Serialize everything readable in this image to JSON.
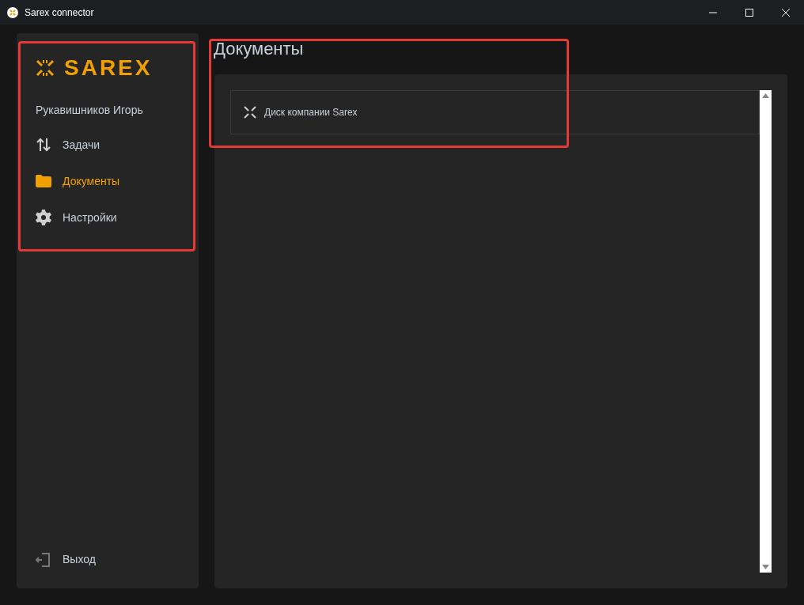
{
  "window": {
    "title": "Sarex connector"
  },
  "sidebar": {
    "logo": "SAREX",
    "user": "Рукавишников Игорь",
    "items": [
      {
        "kind": "tasks",
        "label": "Задачи",
        "selected": false
      },
      {
        "kind": "documents",
        "label": "Документы",
        "selected": true
      },
      {
        "kind": "settings",
        "label": "Настройки",
        "selected": false
      }
    ],
    "logout": "Выход"
  },
  "main": {
    "heading": "Документы",
    "items": [
      {
        "label": "Диск компании Sarex"
      }
    ]
  }
}
